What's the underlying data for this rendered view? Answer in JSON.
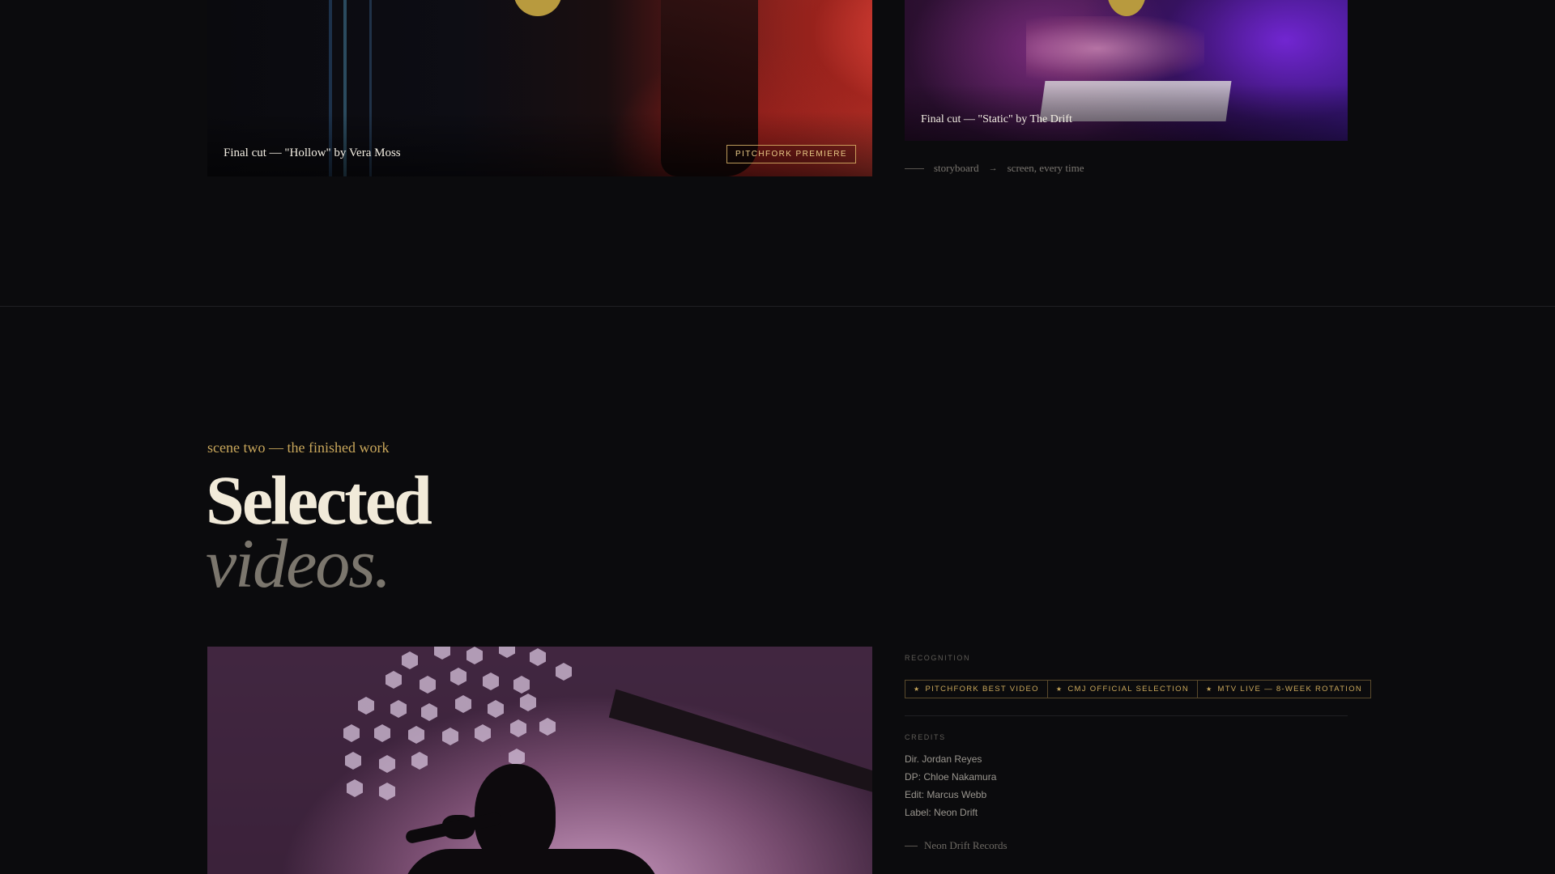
{
  "top_cards": {
    "left": {
      "caption": "Final cut — \"Hollow\" by Vera Moss",
      "badge": "PITCHFORK PREMIERE"
    },
    "right": {
      "caption": "Final cut — \"Static\" by The Drift"
    }
  },
  "tagline": {
    "text": "storyboard",
    "arrow": "→",
    "rest": "screen, every time"
  },
  "section": {
    "eyebrow": "scene two — the finished work",
    "title_line1": "Selected",
    "title_line2": "videos."
  },
  "feature": {
    "recognition_label": "RECOGNITION",
    "awards": [
      {
        "icon": "star-icon",
        "star": "★",
        "label": "PITCHFORK BEST VIDEO"
      },
      {
        "icon": "star-icon",
        "star": "★",
        "label": "CMJ OFFICIAL SELECTION"
      },
      {
        "icon": "star-icon",
        "star": "★",
        "label": "MTV LIVE — 8-WEEK ROTATION"
      }
    ],
    "credits_label": "CREDITS",
    "credits": [
      "Dir. Jordan Reyes",
      "DP: Chloe Nakamura",
      "Edit: Marcus Webb",
      "Label: Neon Drift"
    ],
    "label_name": "Neon Drift Records"
  },
  "colors": {
    "accent_gold": "#c9a75b",
    "background": "#0b0b0d",
    "title": "#f1ead9",
    "title_muted": "#7b766d"
  }
}
